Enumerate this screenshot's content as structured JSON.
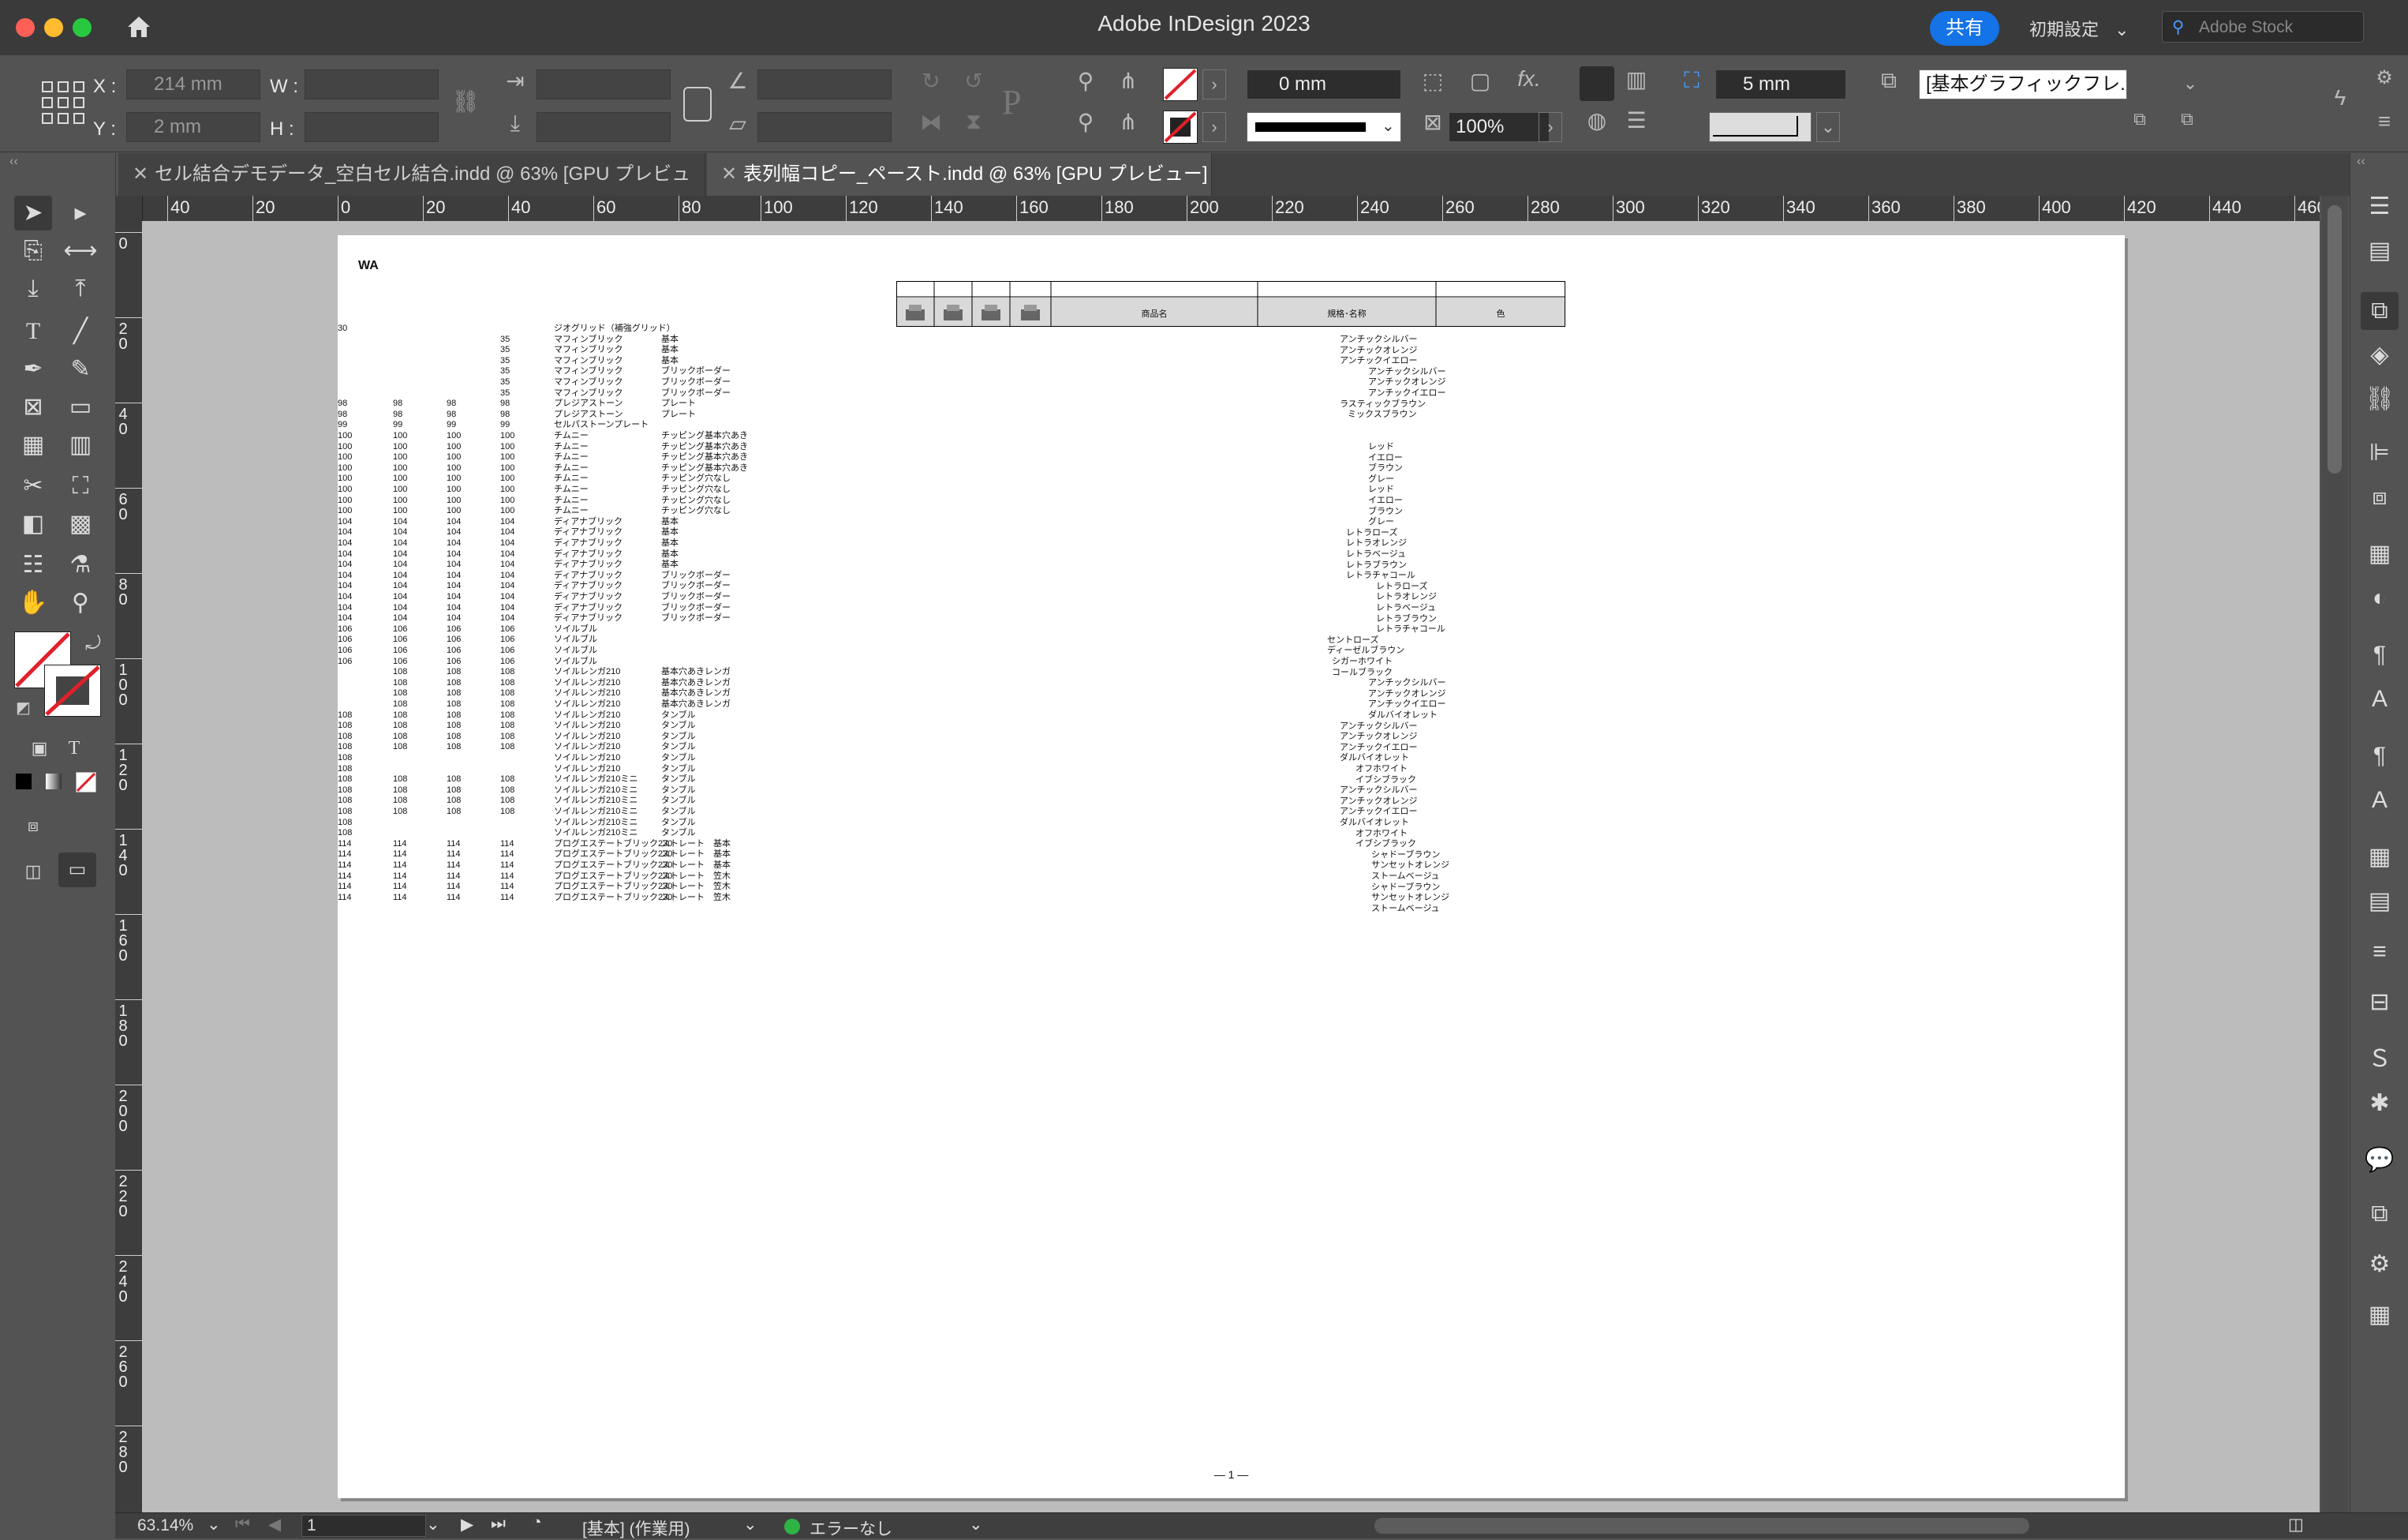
{
  "window": {
    "title": "Adobe InDesign 2023"
  },
  "titlebar": {
    "share_label": "共有",
    "workspace_label": "初期設定",
    "search_placeholder": "Adobe Stock"
  },
  "control": {
    "x_label": "X :",
    "x_value": "214 mm",
    "y_label": "Y :",
    "y_value": "2 mm",
    "w_label": "W :",
    "h_label": "H :",
    "stroke_weight": "0 mm",
    "opacity": "100%",
    "spacing": "5 mm",
    "object_style": "[基本グラフィックフレ..."
  },
  "tabs": [
    {
      "label": "セル結合デモデータ_空白セル結合.indd @ 63% [GPU プレビュー]"
    },
    {
      "label": "表列幅コピー_ペースト.indd @ 63% [GPU プレビュー]"
    }
  ],
  "ruler": {
    "h_ticks": [
      "40",
      "20",
      "0",
      "20",
      "40",
      "60",
      "80",
      "100",
      "120",
      "140",
      "160",
      "180",
      "200",
      "220",
      "240",
      "260",
      "280",
      "300",
      "320",
      "340",
      "360",
      "380",
      "400",
      "420",
      "440",
      "460"
    ],
    "v_ticks": [
      "0",
      "20",
      "40",
      "60",
      "80",
      "100",
      "120",
      "140",
      "160",
      "180",
      "200",
      "220",
      "240",
      "260",
      "280"
    ]
  },
  "page_content": {
    "heading": "WA",
    "table_header": [
      "",
      "",
      "",
      "",
      "商品名",
      "規格･名称",
      "色"
    ],
    "left_rows": [
      [
        "30",
        "",
        "",
        "",
        "ジオグリッド（補強グリッド）",
        ""
      ],
      [
        "",
        "",
        "",
        "35",
        "マフィンブリック",
        "基本"
      ],
      [
        "",
        "",
        "",
        "35",
        "マフィンブリック",
        "基本"
      ],
      [
        "",
        "",
        "",
        "35",
        "マフィンブリック",
        "基本"
      ],
      [
        "",
        "",
        "",
        "35",
        "マフィンブリック",
        "ブリックボーダー"
      ],
      [
        "",
        "",
        "",
        "35",
        "マフィンブリック",
        "ブリックボーダー"
      ],
      [
        "",
        "",
        "",
        "35",
        "マフィンブリック",
        "ブリックボーダー"
      ],
      [
        "98",
        "98",
        "98",
        "98",
        "プレジアストーン",
        "プレート"
      ],
      [
        "98",
        "98",
        "98",
        "98",
        "プレジアストーン",
        "プレート"
      ],
      [
        "99",
        "99",
        "99",
        "99",
        "セルパストーンプレート",
        ""
      ],
      [
        "100",
        "100",
        "100",
        "100",
        "チムニー",
        "チッピング基本穴あき"
      ],
      [
        "100",
        "100",
        "100",
        "100",
        "チムニー",
        "チッピング基本穴あき"
      ],
      [
        "100",
        "100",
        "100",
        "100",
        "チムニー",
        "チッピング基本穴あき"
      ],
      [
        "100",
        "100",
        "100",
        "100",
        "チムニー",
        "チッピング基本穴あき"
      ],
      [
        "100",
        "100",
        "100",
        "100",
        "チムニー",
        "チッピング穴なし"
      ],
      [
        "100",
        "100",
        "100",
        "100",
        "チムニー",
        "チッピング穴なし"
      ],
      [
        "100",
        "100",
        "100",
        "100",
        "チムニー",
        "チッピング穴なし"
      ],
      [
        "100",
        "100",
        "100",
        "100",
        "チムニー",
        "チッピング穴なし"
      ],
      [
        "104",
        "104",
        "104",
        "104",
        "ディアナブリック",
        "基本"
      ],
      [
        "104",
        "104",
        "104",
        "104",
        "ディアナブリック",
        "基本"
      ],
      [
        "104",
        "104",
        "104",
        "104",
        "ディアナブリック",
        "基本"
      ],
      [
        "104",
        "104",
        "104",
        "104",
        "ディアナブリック",
        "基本"
      ],
      [
        "104",
        "104",
        "104",
        "104",
        "ディアナブリック",
        "基本"
      ],
      [
        "104",
        "104",
        "104",
        "104",
        "ディアナブリック",
        "ブリックボーダー"
      ],
      [
        "104",
        "104",
        "104",
        "104",
        "ディアナブリック",
        "ブリックボーダー"
      ],
      [
        "104",
        "104",
        "104",
        "104",
        "ディアナブリック",
        "ブリックボーダー"
      ],
      [
        "104",
        "104",
        "104",
        "104",
        "ディアナブリック",
        "ブリックボーダー"
      ],
      [
        "104",
        "104",
        "104",
        "104",
        "ディアナブリック",
        "ブリックボーダー"
      ],
      [
        "106",
        "106",
        "106",
        "106",
        "ソイルブル",
        ""
      ],
      [
        "106",
        "106",
        "106",
        "106",
        "ソイルブル",
        ""
      ],
      [
        "106",
        "106",
        "106",
        "106",
        "ソイルブル",
        ""
      ],
      [
        "106",
        "106",
        "106",
        "106",
        "ソイルブル",
        ""
      ],
      [
        "",
        "108",
        "108",
        "108",
        "ソイルレンガ210",
        "基本穴あきレンガ"
      ],
      [
        "",
        "108",
        "108",
        "108",
        "ソイルレンガ210",
        "基本穴あきレンガ"
      ],
      [
        "",
        "108",
        "108",
        "108",
        "ソイルレンガ210",
        "基本穴あきレンガ"
      ],
      [
        "",
        "108",
        "108",
        "108",
        "ソイルレンガ210",
        "基本穴あきレンガ"
      ],
      [
        "108",
        "108",
        "108",
        "108",
        "ソイルレンガ210",
        "タンブル"
      ],
      [
        "108",
        "108",
        "108",
        "108",
        "ソイルレンガ210",
        "タンブル"
      ],
      [
        "108",
        "108",
        "108",
        "108",
        "ソイルレンガ210",
        "タンブル"
      ],
      [
        "108",
        "108",
        "108",
        "108",
        "ソイルレンガ210",
        "タンブル"
      ],
      [
        "108",
        "",
        "",
        "",
        "ソイルレンガ210",
        "タンブル"
      ],
      [
        "108",
        "",
        "",
        "",
        "ソイルレンガ210",
        "タンブル"
      ],
      [
        "108",
        "108",
        "108",
        "108",
        "ソイルレンガ210ミニ",
        "タンブル"
      ],
      [
        "108",
        "108",
        "108",
        "108",
        "ソイルレンガ210ミニ",
        "タンブル"
      ],
      [
        "108",
        "108",
        "108",
        "108",
        "ソイルレンガ210ミニ",
        "タンブル"
      ],
      [
        "108",
        "108",
        "108",
        "108",
        "ソイルレンガ210ミニ",
        "タンブル"
      ],
      [
        "108",
        "",
        "",
        "",
        "ソイルレンガ210ミニ",
        "タンブル"
      ],
      [
        "108",
        "",
        "",
        "",
        "ソイルレンガ210ミニ",
        "タンブル"
      ],
      [
        "114",
        "114",
        "114",
        "114",
        "プログエステートブリック230",
        "ストレート　基本"
      ],
      [
        "114",
        "114",
        "114",
        "114",
        "プログエステートブリック230",
        "ストレート　基本"
      ],
      [
        "114",
        "114",
        "114",
        "114",
        "プログエステートブリック230",
        "ストレート　基本"
      ],
      [
        "114",
        "114",
        "114",
        "114",
        "プログエステートブリック230",
        "ストレート　笠木"
      ],
      [
        "114",
        "114",
        "114",
        "114",
        "プログエステートブリック230",
        "ストレート　笠木"
      ],
      [
        "114",
        "114",
        "114",
        "114",
        "プログエステートブリック230",
        "ストレート　笠木"
      ]
    ],
    "color_rows": [
      "アンチックシルバー",
      "アンチックオレンジ",
      "アンチックイエロー",
      "アンチックシルバー",
      "アンチックオレンジ",
      "アンチックイエロー",
      "ラスティックブラウン",
      "ミックスブラウン",
      "",
      "",
      "レッド",
      "イエロー",
      "ブラウン",
      "グレー",
      "レッド",
      "イエロー",
      "ブラウン",
      "グレー",
      "レトラローズ",
      "レトラオレンジ",
      "レトラベージュ",
      "レトラブラウン",
      "レトラチャコール",
      "レトラローズ",
      "レトラオレンジ",
      "レトラベージュ",
      "レトラブラウン",
      "レトラチャコール",
      "セントローズ",
      "ディーゼルブラウン",
      "シガーホワイト",
      "コールブラック",
      "アンチックシルバー",
      "アンチックオレンジ",
      "アンチックイエロー",
      "ダルバイオレット",
      "アンチックシルバー",
      "アンチックオレンジ",
      "アンチックイエロー",
      "ダルバイオレット",
      "オフホワイト",
      "イブシブラック",
      "アンチックシルバー",
      "アンチックオレンジ",
      "アンチックイエロー",
      "ダルバイオレット",
      "オフホワイト",
      "イブシブラック",
      "シャドーブラウン",
      "サンセットオレンジ",
      "ストームベージュ",
      "シャドーブラウン",
      "サンセットオレンジ",
      "ストームベージュ"
    ],
    "page_number": "— 1 —"
  },
  "status": {
    "zoom": "63.14%",
    "page": "1",
    "master": "[基本] (作業用)",
    "preflight": "エラーなし"
  },
  "colors": {
    "accent": "#1473e6",
    "status_ok": "#2fb344",
    "chrome": "#535353",
    "titlebar": "#3a3a3a"
  }
}
